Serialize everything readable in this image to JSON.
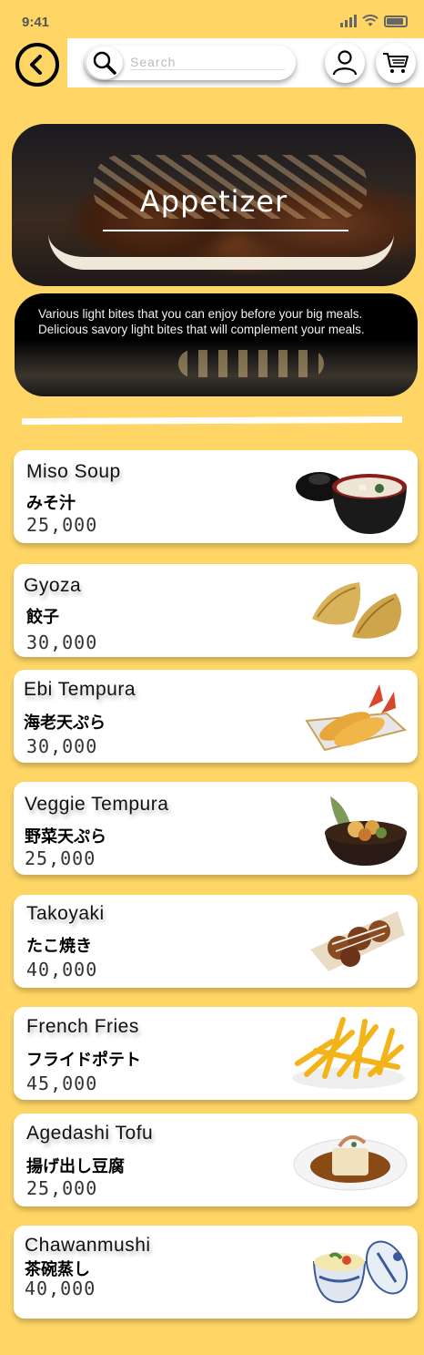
{
  "status": {
    "time": "9:41"
  },
  "header": {
    "search_placeholder": "Search"
  },
  "banner": {
    "title": "Appetizer",
    "description_line1": "Various light bites that you can enjoy before your big meals.",
    "description_line2": "Delicious savory light bites that will complement your meals."
  },
  "menu": [
    {
      "name": "Miso Soup",
      "jp": "みそ汁",
      "price": "25,000"
    },
    {
      "name": "Gyoza",
      "jp": "餃子",
      "price": "30,000"
    },
    {
      "name": "Ebi Tempura",
      "jp": "海老天ぷら",
      "price": "30,000"
    },
    {
      "name": "Veggie Tempura",
      "jp": "野菜天ぷら",
      "price": "25,000"
    },
    {
      "name": "Takoyaki",
      "jp": "たこ焼き",
      "price": "40,000"
    },
    {
      "name": "French Fries",
      "jp": "フライドポテト",
      "price": "45,000"
    },
    {
      "name": "Agedashi Tofu",
      "jp": "揚げ出し豆腐",
      "price": "25,000"
    },
    {
      "name": "Chawanmushi",
      "jp": "茶碗蒸し",
      "price": "40,000"
    }
  ],
  "colors": {
    "background": "#ffd666",
    "card": "#ffffff",
    "text": "#111111"
  },
  "icons": {
    "back": "back-arrow-icon",
    "search": "search-icon",
    "profile": "user-icon",
    "cart": "cart-icon"
  }
}
